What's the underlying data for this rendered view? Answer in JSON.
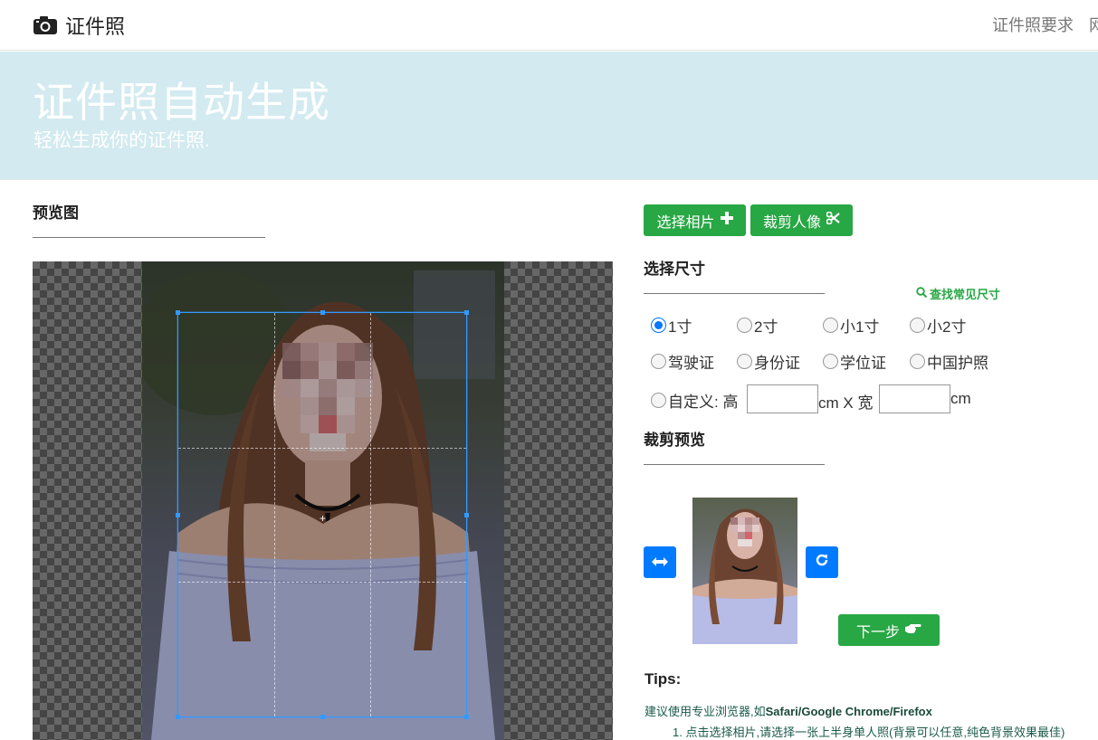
{
  "navbar": {
    "brand": "证件照",
    "links": [
      "证件照要求",
      "网"
    ]
  },
  "hero": {
    "title": "证件照自动生成",
    "subtitle": "轻松生成你的证件照."
  },
  "preview": {
    "title": "预览图"
  },
  "actions": {
    "select_photo": "选择相片",
    "crop_portrait": "裁剪人像"
  },
  "size": {
    "title": "选择尺寸",
    "lookup_link": "查找常见尺寸",
    "options": [
      "1寸",
      "2寸",
      "小1寸",
      "小2寸",
      "驾驶证",
      "身份证",
      "学位证",
      "中国护照"
    ],
    "selected": "1寸",
    "custom": {
      "label": "自定义: 高",
      "unit_height": "cm X 宽",
      "unit_width": "cm",
      "height_value": "",
      "width_value": ""
    }
  },
  "crop_preview": {
    "title": "裁剪预览",
    "next_button": "下一步"
  },
  "tips": {
    "title": "Tips:",
    "browser_prefix": "建议使用专业浏览器,如",
    "browsers": "Safari/Google Chrome/Firefox",
    "step1": "1. 点击选择相片,请选择一张上半身单人照(背景可以任意,纯色背景效果最佳)"
  },
  "colors": {
    "green": "#28a745",
    "blue": "#007bff",
    "hero_bg": "#d2eaf0",
    "crop_border": "#3399ff"
  }
}
